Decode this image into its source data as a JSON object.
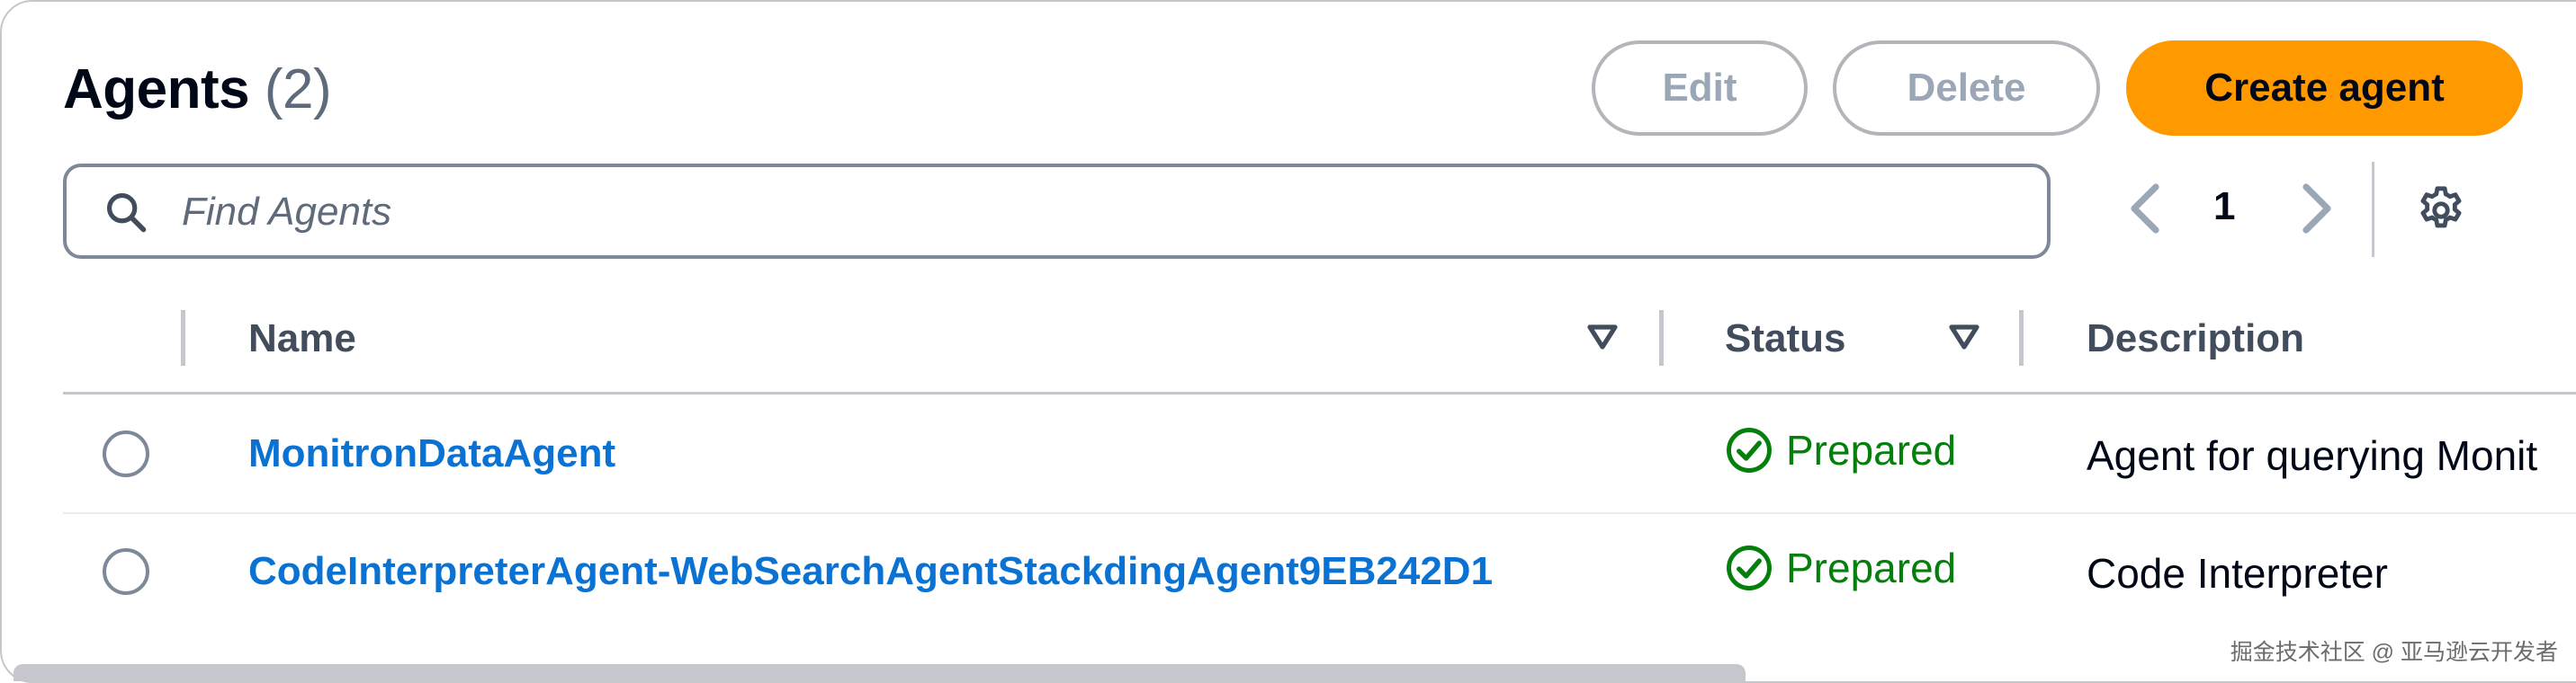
{
  "header": {
    "title": "Agents",
    "count": "(2)",
    "edit_label": "Edit",
    "delete_label": "Delete",
    "create_label": "Create agent"
  },
  "search": {
    "placeholder": "Find Agents",
    "value": ""
  },
  "pagination": {
    "current_page": "1"
  },
  "table": {
    "columns": [
      "Name",
      "Status",
      "Description"
    ],
    "rows": [
      {
        "name": "MonitronDataAgent",
        "status": "Prepared",
        "description": "Agent for querying Monit"
      },
      {
        "name": "CodeInterpreterAgent-WebSearchAgentStackdingAgent9EB242D1",
        "status": "Prepared",
        "description": "Code Interpreter"
      }
    ]
  },
  "watermark": "掘金技术社区 @ 亚马逊云开发者",
  "colors": {
    "primary": "#ff9900",
    "link": "#0972d3",
    "success": "#037f0c",
    "border": "#c6c6cd"
  },
  "icons": [
    "search-icon",
    "chevron-left-icon",
    "chevron-right-icon",
    "gear-icon",
    "sort-down-icon",
    "check-circle-icon"
  ]
}
